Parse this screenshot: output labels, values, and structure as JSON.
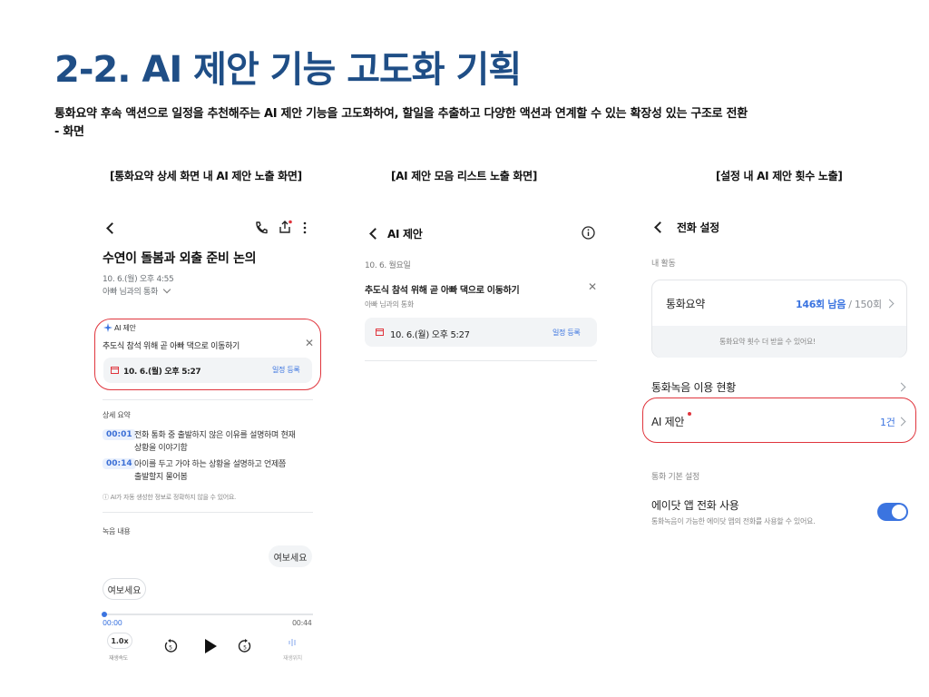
{
  "slide": {
    "title": "2-2. AI 제안 기능 고도화 기획",
    "description_line1": "통화요약 후속 액션으로 일정을 추천해주는 AI 제안 기능을 고도화하여, 할일을 추출하고 다양한 액션과 연계할 수 있는 확장성 있는 구조로 전환",
    "description_line2": "- 화면"
  },
  "captions": {
    "left": "[통화요약 상세 화면 내 AI 제안 노출 화면]",
    "middle": "[AI 제안 모음 리스트 노출 화면]",
    "right": "[설정 내 AI 제안 횟수 노출]"
  },
  "detail_screen": {
    "call_title": "수연이 돌봄과 외출 준비 논의",
    "datetime": "10. 6.(월) 오후 4:55",
    "contact": "아빠 님과의 통화",
    "ai_label": "AI 제안",
    "suggestion_text": "추도식 참석 위해 곧 아빠 댁으로 이동하기",
    "schedule_date": "10. 6.(월) 오후 5:27",
    "schedule_button": "일정 등록",
    "summary_header": "상세 요약",
    "summary_items": [
      {
        "time": "00:01",
        "line1": "전화 통화 중 출발하지 않은 이유를 설명하며 현재",
        "line2": "상황을 이야기함"
      },
      {
        "time": "00:14",
        "line1": "아이를 두고 가야 하는 상황을 설명하고 언제쯤",
        "line2": "출발할지 물어봄"
      }
    ],
    "disclaimer": "ⓘ AI가 자동 생성한 정보로 정확하지 않을 수 있어요.",
    "recording_header": "녹음 내용",
    "bubble_right": "여보세요",
    "bubble_left": "여보세요",
    "time_start": "00:00",
    "time_end": "00:44",
    "speed": "1.0x",
    "speed_label": "재생속도",
    "rewind_label": "5",
    "forward_label": "5",
    "wave_label": "재생위치"
  },
  "list_screen": {
    "header": "AI 제안",
    "date_header": "10. 6. 월요일",
    "item_title": "추도식 참석 위해 곧 아빠 댁으로 이동하기",
    "item_contact": "아빠 님과의 통화",
    "schedule_date": "10. 6.(월) 오후 5:27",
    "schedule_button": "일정 등록"
  },
  "settings_screen": {
    "header": "전화 설정",
    "section_activity": "내 활동",
    "summary_label": "통화요약",
    "summary_remaining": "146회 남음",
    "summary_total": " / 150회",
    "summary_note": "통화요약 횟수 더 받을 수 있어요!",
    "recording_usage": "통화녹음 이용 현황",
    "ai_suggest_label": "AI 제안",
    "ai_suggest_count": "1건",
    "section_basic": "통화 기본 설정",
    "adot_label": "에이닷 앱 전화 사용",
    "adot_desc": "통화녹음이 가능한 에이닷 앱의 전화를 사용할 수 있어요."
  },
  "colors": {
    "title": "#1f4e86",
    "accent": "#3b74e0",
    "highlight": "#e0353d"
  }
}
